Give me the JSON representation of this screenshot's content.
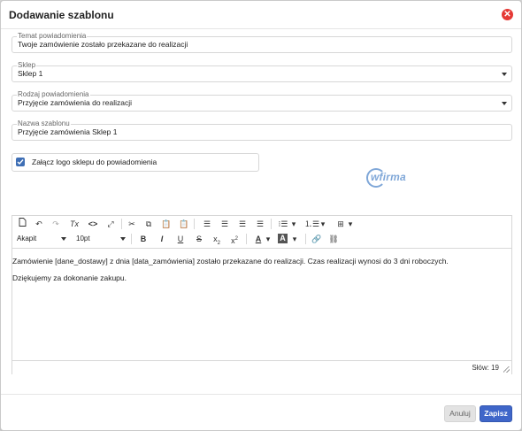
{
  "dialog": {
    "title": "Dodawanie szablonu",
    "close_icon": "close-circle-icon"
  },
  "form": {
    "subject_label": "Temat powiadomienia",
    "subject_value": "Twoje zamówienie zostało przekazane do realizacji",
    "shop_label": "Sklep",
    "shop_value": "Sklep 1",
    "type_label": "Rodzaj powiadomienia",
    "type_value": "Przyjęcie zamówienia do realizacji",
    "name_label": "Nazwa szablonu",
    "name_value": "Przyjęcie zamówienia Sklep 1",
    "logo_checkbox_label": "Załącz logo sklepu do powiadomienia",
    "logo_checkbox_checked": true
  },
  "brand": {
    "logo_text": "wfirma",
    "color": "#7fa7d8"
  },
  "editor": {
    "font_select": "Akapit",
    "size_select": "10pt",
    "paragraphs": [
      "Zamówienie [dane_dostawy] z dnia [data_zamówienia] zostało przekazane do realizacji. Czas realizacji wynosi do 3 dni roboczych.",
      "Dziękujemy za dokonanie zakupu."
    ],
    "word_count": "Słów: 19"
  },
  "footer": {
    "cancel_label": "Anuluj",
    "save_label": "Zapisz"
  },
  "colors": {
    "accent": "#3f66c9",
    "close": "#e53935"
  }
}
